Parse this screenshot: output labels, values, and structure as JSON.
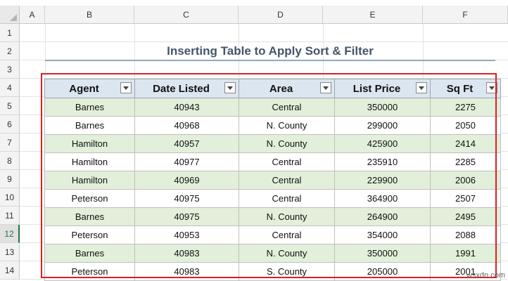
{
  "sheet": {
    "column_headers": [
      "A",
      "B",
      "C",
      "D",
      "E",
      "F"
    ],
    "row_headers": [
      "1",
      "2",
      "3",
      "4",
      "5",
      "6",
      "7",
      "8",
      "9",
      "10",
      "11",
      "12",
      "13",
      "14"
    ],
    "active_row": "12",
    "title": "Inserting Table to Apply Sort & Filter"
  },
  "table": {
    "headers": [
      "Agent",
      "Date Listed",
      "Area",
      "List Price",
      "Sq Ft"
    ],
    "rows": [
      [
        "Barnes",
        "40943",
        "Central",
        "350000",
        "2275"
      ],
      [
        "Barnes",
        "40968",
        "N. County",
        "299000",
        "2050"
      ],
      [
        "Hamilton",
        "40957",
        "N. County",
        "425900",
        "2414"
      ],
      [
        "Hamilton",
        "40977",
        "Central",
        "235910",
        "2285"
      ],
      [
        "Hamilton",
        "40969",
        "Central",
        "229900",
        "2006"
      ],
      [
        "Peterson",
        "40975",
        "Central",
        "364900",
        "2507"
      ],
      [
        "Barnes",
        "40975",
        "N. County",
        "264900",
        "2495"
      ],
      [
        "Peterson",
        "40953",
        "Central",
        "354000",
        "2088"
      ],
      [
        "Barnes",
        "40983",
        "N. County",
        "350000",
        "1991"
      ],
      [
        "Peterson",
        "40983",
        "S. County",
        "205000",
        "2001"
      ]
    ]
  },
  "colors": {
    "header_fill": "#dce6f1",
    "band_fill": "#e2efda",
    "highlight_border": "#e02020",
    "title_color": "#44546a"
  },
  "watermark": "wsxdn.com"
}
